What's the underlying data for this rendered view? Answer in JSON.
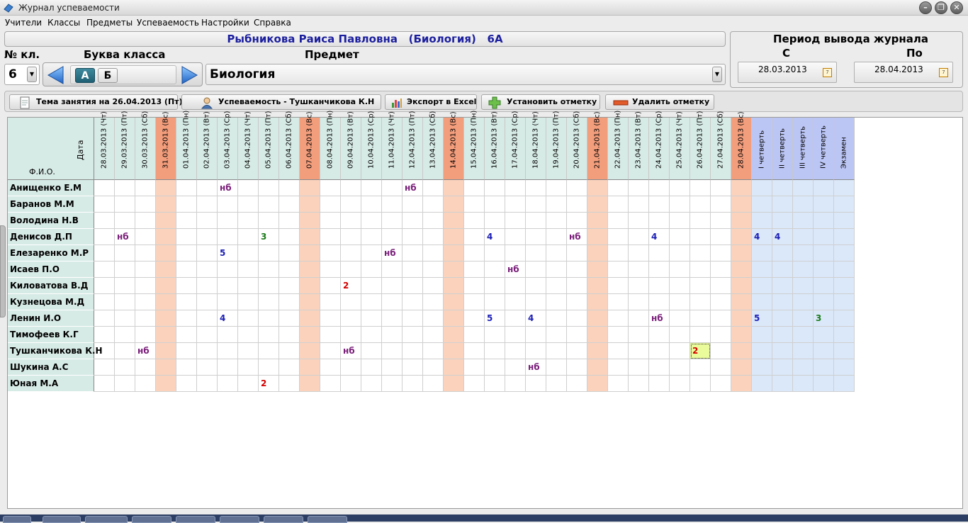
{
  "window": {
    "title": "Журнал успеваемости"
  },
  "menu": [
    "Учители",
    "Классы",
    "Предметы",
    "Успеваемость",
    "Настройки",
    "Справка"
  ],
  "header": {
    "teacher_line": "Рыбникова Раиса Павловна   (Биология)   6А"
  },
  "labels": {
    "class_num": "№ кл.",
    "class_letter": "Буква класса",
    "subject": "Предмет"
  },
  "class_number": "6",
  "letters": [
    "А",
    "Б"
  ],
  "selected_letter": "А",
  "subject_value": "Биология",
  "period": {
    "title": "Период вывода журнала",
    "from_label": "С",
    "to_label": "По",
    "from": "28.03.2013",
    "to": "28.04.2013"
  },
  "toolbar": {
    "topic": "Тема занятия на 26.04.2013 (Пт)",
    "progress": "Успеваемость - Тушканчикова К.Н",
    "excel": "Экспорт в Excel",
    "set_mark": "Установить отметку",
    "delete_mark": "Удалить отметку"
  },
  "grid": {
    "corner_date": "Дата",
    "corner_name": "Ф.И.О.",
    "columns": [
      "28.03.2013 (Чт)",
      "29.03.2013 (Пт)",
      "30.03.2013 (Сб)",
      "31.03.2013 (Вс)",
      "01.04.2013 (Пн)",
      "02.04.2013 (Вт)",
      "03.04.2013 (Ср)",
      "04.04.2013 (Чт)",
      "05.04.2013 (Пт)",
      "06.04.2013 (Сб)",
      "07.04.2013 (Вс)",
      "08.04.2013 (Пн)",
      "09.04.2013 (Вт)",
      "10.04.2013 (Ср)",
      "11.04.2013 (Чт)",
      "12.04.2013 (Пт)",
      "13.04.2013 (Сб)",
      "14.04.2013 (Вс)",
      "15.04.2013 (Пн)",
      "16.04.2013 (Вт)",
      "17.04.2013 (Ср)",
      "18.04.2013 (Чт)",
      "19.04.2013 (Пт)",
      "20.04.2013 (Сб)",
      "21.04.2013 (Вс)",
      "22.04.2013 (Пн)",
      "23.04.2013 (Вт)",
      "24.04.2013 (Ср)",
      "25.04.2013 (Чт)",
      "26.04.2013 (Пт)",
      "27.04.2013 (Сб)",
      "28.04.2013 (Вс)",
      "I четверть",
      "II четверть",
      "III четверть",
      "IV четверть",
      "Экзамен"
    ],
    "sunday_columns": [
      3,
      10,
      17,
      24,
      31
    ],
    "quarter_columns": [
      32,
      33,
      34,
      35,
      36
    ],
    "students": [
      {
        "name": "Анищенко Е.М",
        "marks": {
          "6": "нб",
          "15": "нб"
        }
      },
      {
        "name": "Баранов М.М",
        "marks": {}
      },
      {
        "name": "Володина Н.В",
        "marks": {}
      },
      {
        "name": "Денисов Д.П",
        "marks": {
          "1": "нб",
          "8": "3",
          "19": "4",
          "23": "нб",
          "27": "4",
          "32": "4",
          "33": "4"
        }
      },
      {
        "name": "Елезаренко М.Р",
        "marks": {
          "6": "5",
          "14": "нб"
        }
      },
      {
        "name": "Исаев П.О",
        "marks": {
          "20": "нб"
        }
      },
      {
        "name": "Киловатова В.Д",
        "marks": {
          "12": "2"
        }
      },
      {
        "name": "Кузнецова М.Д",
        "marks": {}
      },
      {
        "name": "Ленин И.О",
        "marks": {
          "6": "4",
          "19": "5",
          "21": "4",
          "27": "нб",
          "32": "5",
          "35": "3"
        }
      },
      {
        "name": "Тимофеев К.Г",
        "marks": {}
      },
      {
        "name": "Тушканчикова К.Н",
        "marks": {
          "2": "нб",
          "12": "нб",
          "29": "2"
        }
      },
      {
        "name": "Шукина А.С",
        "marks": {
          "21": "нб"
        }
      },
      {
        "name": "Юная М.А",
        "marks": {
          "8": "2"
        }
      }
    ],
    "selected_cell": {
      "row": 10,
      "col": 29
    }
  },
  "mark_colors": {
    "нб": "#7a1f7a",
    "2": "#d40000",
    "3": "#1a7a1a",
    "4": "#1c1fb5",
    "5": "#1c1fb5"
  }
}
